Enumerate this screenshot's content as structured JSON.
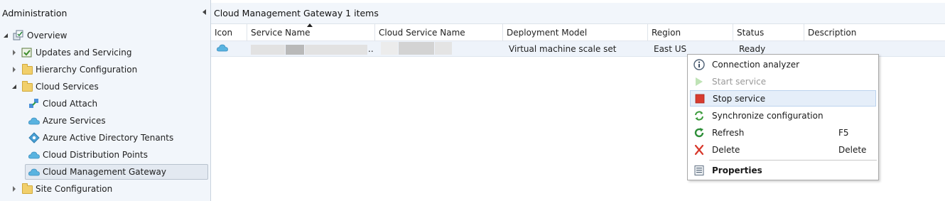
{
  "left_pane": {
    "title": "Administration",
    "tree": [
      {
        "label": "Overview",
        "icon": "overview-icon",
        "expander": "down"
      },
      {
        "label": "Updates and Servicing",
        "icon": "updates-servicing-icon",
        "expander": "right"
      },
      {
        "label": "Hierarchy Configuration",
        "icon": "folder-icon",
        "expander": "right"
      },
      {
        "label": "Cloud Services",
        "icon": "folder-icon",
        "expander": "down"
      },
      {
        "label": "Cloud Attach",
        "icon": "cloud-attach-icon",
        "expander": "none"
      },
      {
        "label": "Azure Services",
        "icon": "cloud-icon",
        "expander": "none"
      },
      {
        "label": "Azure Active Directory Tenants",
        "icon": "aad-tenant-icon",
        "expander": "none"
      },
      {
        "label": "Cloud Distribution Points",
        "icon": "cloud-icon",
        "expander": "none"
      },
      {
        "label": "Cloud Management Gateway",
        "icon": "cloud-icon",
        "expander": "none",
        "selected": true
      },
      {
        "label": "Site Configuration",
        "icon": "folder-icon",
        "expander": "right"
      }
    ]
  },
  "main": {
    "header": "Cloud Management Gateway 1 items",
    "columns": [
      "Icon",
      "Service Name",
      "Cloud Service Name",
      "Deployment Model",
      "Region",
      "Status",
      "Description"
    ],
    "row": {
      "service_name_suffix": "..",
      "deployment_model": "Virtual machine scale set",
      "region": "East US",
      "status": "Ready",
      "description": ""
    }
  },
  "context_menu": {
    "items": [
      {
        "label": "Connection analyzer",
        "icon": "info-icon",
        "shortcut": ""
      },
      {
        "label": "Start service",
        "icon": "play-icon",
        "shortcut": "",
        "disabled": true
      },
      {
        "label": "Stop service",
        "icon": "stop-icon",
        "shortcut": "",
        "hover": true
      },
      {
        "label": "Synchronize configuration",
        "icon": "sync-icon",
        "shortcut": ""
      },
      {
        "label": "Refresh",
        "icon": "refresh-icon",
        "shortcut": "F5"
      },
      {
        "label": "Delete",
        "icon": "delete-icon",
        "shortcut": "Delete"
      },
      {
        "label": "Properties",
        "icon": "properties-icon",
        "shortcut": "",
        "bold": true
      }
    ]
  },
  "colors": {
    "pane_bg": "#f2f6fb",
    "selected_row_bg": "#eef3fa",
    "menu_hover_bg": "#e5eef9",
    "stop_red": "#d83b2f",
    "cloud_blue": "#59b3e0"
  }
}
